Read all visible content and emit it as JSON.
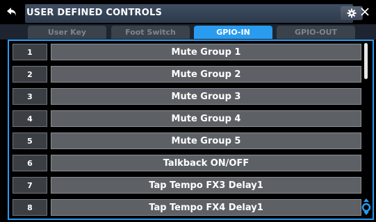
{
  "window": {
    "title": "USER DEFINED CONTROLS",
    "back_icon": "back-arrow-icon",
    "settings_icon": "gear-icon",
    "close_icon": "close-icon"
  },
  "tabs": [
    {
      "label": "User Key",
      "active": false
    },
    {
      "label": "Foot Switch",
      "active": false
    },
    {
      "label": "GPIO-IN",
      "active": true
    },
    {
      "label": "GPIO-OUT",
      "active": false
    }
  ],
  "rows": [
    {
      "number": "1",
      "label": "Mute Group 1"
    },
    {
      "number": "2",
      "label": "Mute Group 2"
    },
    {
      "number": "3",
      "label": "Mute Group 3"
    },
    {
      "number": "4",
      "label": "Mute Group 4"
    },
    {
      "number": "5",
      "label": "Mute Group 5"
    },
    {
      "number": "6",
      "label": "Talkback ON/OFF"
    },
    {
      "number": "7",
      "label": "Tap Tempo FX3 Delay1"
    },
    {
      "number": "8",
      "label": "Tap Tempo FX4 Delay1"
    }
  ],
  "colors": {
    "accent": "#2a9cf0",
    "title_bar": "#3f4e63",
    "row_label_bg": "#5d6166",
    "row_number_bg": "#3b3f44"
  }
}
